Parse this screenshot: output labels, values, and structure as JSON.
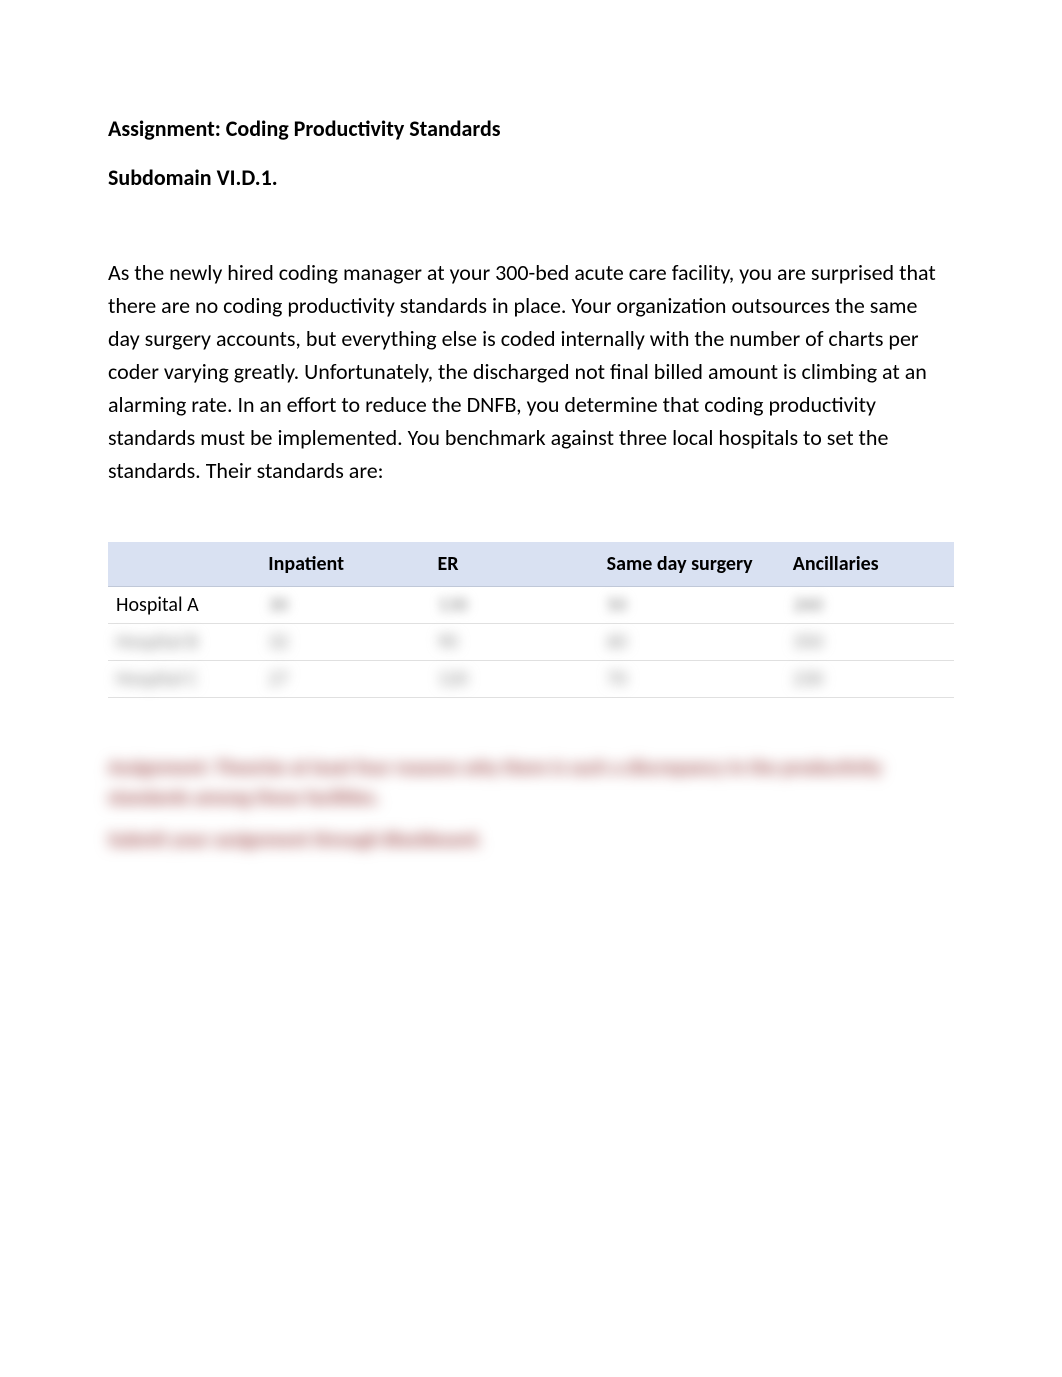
{
  "title": "Assignment:  Coding Productivity Standards",
  "subtitle": "Subdomain VI.D.1.",
  "paragraph": "As the newly hired coding manager at your 300-bed acute care facility, you are surprised that there are no coding productivity standards in place.  Your organization outsources the same day surgery accounts, but everything else is coded internally with the number of charts per coder varying greatly.  Unfortunately, the discharged not final billed amount is climbing at an alarming rate.  In an effort to reduce the DNFB, you determine that coding productivity standards must be implemented.  You benchmark against three local hospitals to set the standards.  Their standards are:",
  "table": {
    "headers": [
      "",
      "Inpatient",
      "ER",
      "Same day surgery",
      "Ancillaries"
    ],
    "rows": [
      {
        "label": "Hospital A",
        "values": [
          "30",
          "130",
          "50",
          "260"
        ]
      },
      {
        "label": "Hospital B",
        "values": [
          "32",
          "90",
          "60",
          "350"
        ]
      },
      {
        "label": "Hospital C",
        "values": [
          "27",
          "120",
          "70",
          "230"
        ]
      }
    ]
  },
  "blurred": {
    "assignment": "Assignment:  Theorize at least four reasons why there is such a discrepancy in the productivity standards among these facilities.",
    "submit": "Submit your assignment through Blackboard."
  }
}
